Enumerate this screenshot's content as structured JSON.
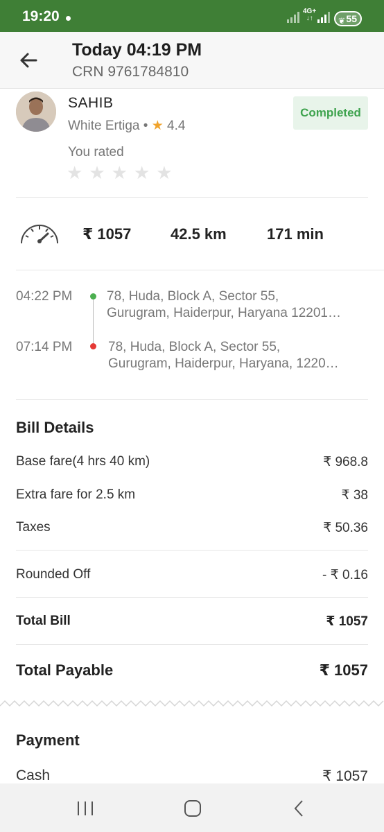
{
  "status_bar": {
    "time": "19:20",
    "network": "4G+",
    "battery": "55"
  },
  "header": {
    "title": "Today 04:19 PM",
    "crn": "CRN 9761784810",
    "back_icon": "arrow-left-icon"
  },
  "driver": {
    "name": "SAHIB",
    "car": "White Ertiga",
    "separator": "•",
    "star_icon": "★",
    "rating": "4.4",
    "status": "Completed",
    "rated_label": "You rated",
    "user_stars": 0,
    "max_stars": 5
  },
  "trip_stats": {
    "fare": "₹ 1057",
    "distance": "42.5 km",
    "duration": "171 min"
  },
  "route": {
    "pickup_time": "04:22 PM",
    "pickup_address_line1": "78, Huda, Block A, Sector 55,",
    "pickup_address_line2": "Gurugram, Haiderpur, Haryana 12201…",
    "drop_time": "07:14 PM",
    "drop_address_line1": "78, Huda, Block A, Sector 55,",
    "drop_address_line2": "Gurugram, Haiderpur, Haryana, 1220…"
  },
  "bill": {
    "title": "Bill Details",
    "rows": [
      {
        "label": "Base fare(4 hrs 40 km)",
        "value": "₹ 968.8"
      },
      {
        "label": "Extra fare for 2.5 km",
        "value": "₹ 38"
      },
      {
        "label": "Taxes",
        "value": "₹ 50.36"
      }
    ],
    "rounded_label": "Rounded Off",
    "rounded_value": "- ₹ 0.16",
    "total_label": "Total Bill",
    "total_value": "₹ 1057",
    "payable_label": "Total Payable",
    "payable_value": "₹ 1057"
  },
  "payment": {
    "title": "Payment",
    "method": "Cash",
    "amount": "₹ 1057"
  },
  "colors": {
    "status_bar": "#3f7f36",
    "completed_text": "#3ea34e",
    "completed_bg": "#e8f4ea",
    "star": "#f0a32c",
    "pickup_dot": "#4caf50",
    "drop_dot": "#e53935"
  }
}
